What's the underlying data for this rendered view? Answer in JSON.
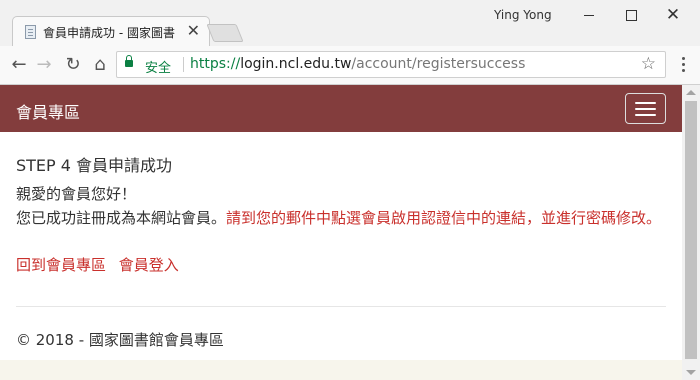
{
  "browser": {
    "tab_title": "會員申請成功 - 國家圖書",
    "tab_close": "✕",
    "user_name": "Ying Yong",
    "secure_label": "安全",
    "url_scheme": "https://",
    "url_host": "login.ncl.edu.tw",
    "url_path": "/account/registersuccess"
  },
  "navbar": {
    "brand": "會員專區",
    "bg_color": "#833d3d"
  },
  "content": {
    "step_title": "STEP 4 會員申請成功",
    "greeting": "親愛的會員您好！",
    "message_normal": "您已成功註冊成為本網站會員。",
    "message_warning": "請到您的郵件中點選會員啟用認證信中的連結，並進行密碼修改。",
    "link_member_area": "回到會員專區",
    "link_login": "會員登入",
    "accent_color": "#c9302c"
  },
  "footer": {
    "text": "© 2018 - 國家圖書館會員專區"
  },
  "icons": [
    "page-icon",
    "close-icon",
    "back-icon",
    "forward-icon",
    "reload-icon",
    "home-icon",
    "lock-icon",
    "star-icon",
    "menu-icon",
    "hamburger-icon"
  ]
}
